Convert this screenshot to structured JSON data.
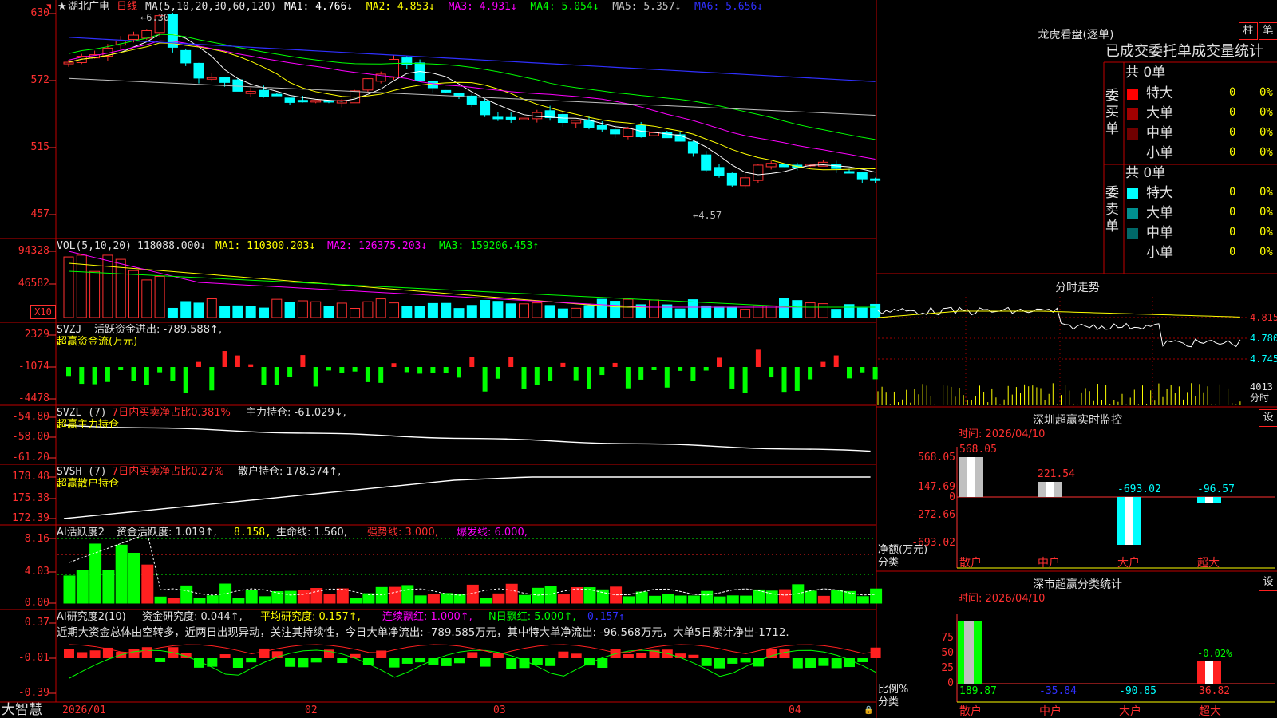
{
  "stock": {
    "star": "★",
    "name": "湖北广电",
    "period": "日线",
    "ma_label": "MA(5,10,20,30,60,120)",
    "ma": [
      {
        "label": "MA1:",
        "value": "4.766↓",
        "color": "#ffffff"
      },
      {
        "label": "MA2:",
        "value": "4.853↓",
        "color": "#ffff00"
      },
      {
        "label": "MA3:",
        "value": "4.931↓",
        "color": "#ff00ff"
      },
      {
        "label": "MA4:",
        "value": "5.054↓",
        "color": "#00ff00"
      },
      {
        "label": "MA5:",
        "value": "5.357↓",
        "color": "#c0c0c0"
      },
      {
        "label": "MA6:",
        "value": "5.656↓",
        "color": "#3030ff"
      }
    ],
    "high_mark": "6.30",
    "low_mark": "4.57"
  },
  "price_axis": [
    "630",
    "572",
    "515",
    "457"
  ],
  "vol": {
    "label": "VOL(5,10,20)",
    "value": "118088.000↓",
    "ma1": "MA1: 110300.203↓",
    "ma2": "MA2: 126375.203↓",
    "ma3": "MA3: 159206.453↑",
    "axis": [
      "94328",
      "46582"
    ],
    "unit": "X10"
  },
  "svzj": {
    "label": "SVZJ",
    "desc": "活跃资金进出: -789.588↑,",
    "sub": "超赢资金流(万元)",
    "axis": [
      "2329",
      "-1074",
      "-4478"
    ]
  },
  "svzl": {
    "label": "SVZL (7)",
    "desc1": "7日内买卖净占比0.381%",
    "desc2": "主力持仓: -61.029↓,",
    "sub": "超赢主力持仓",
    "axis": [
      "-54.80",
      "-58.00",
      "-61.20"
    ]
  },
  "svsh": {
    "label": "SVSH (7)",
    "desc1": "7日内买卖净占比0.27%",
    "desc2": "散户持仓: 178.374↑,",
    "sub": "超赢散户持仓",
    "axis": [
      "178.48",
      "175.38",
      "172.39"
    ]
  },
  "ai_active": {
    "label": "AI活跃度2",
    "a": "资金活跃度: 1.019↑,",
    "b": "8.158,",
    "c": "生命线: 1.560,",
    "d": "强势线: 3.000,",
    "e": "爆发线: 6.000,",
    "axis": [
      "8.16",
      "4.03",
      "0.00"
    ]
  },
  "ai_research": {
    "label": "AI研究度2(10)",
    "a": "资金研究度: 0.044↑,",
    "b": "平均研究度: 0.157↑,",
    "c": "连续飘红: 1.000↑,",
    "d": "N日飘红: 5.000↑,",
    "e": "0.157↑",
    "axis": [
      "0.37",
      "-0.01",
      "-0.39"
    ],
    "comment": "近期大资金总体由空转多，近两日出现异动，关注其持续性，今日大单净流出: -789.585万元，其中特大单净流出: -96.568万元，大单5日累计净出-1712."
  },
  "dates": [
    "2026/01",
    "02",
    "03",
    "04"
  ],
  "brand": "大智慧",
  "longhu": {
    "title": "龙虎看盘(逐单)",
    "btn1": "柱",
    "btn2": "笔",
    "subtitle": "已成交委托单成交量统计",
    "buy": {
      "side": "委买单",
      "total": "共 0单",
      "rows": [
        {
          "label": "特大",
          "v": "0",
          "p": "0%",
          "color": "#ff0000"
        },
        {
          "label": "大单",
          "v": "0",
          "p": "0%",
          "color": "#a00000"
        },
        {
          "label": "中单",
          "v": "0",
          "p": "0%",
          "color": "#700000"
        },
        {
          "label": "小单",
          "v": "0",
          "p": "0%",
          "color": "#000000"
        }
      ]
    },
    "sell": {
      "side": "委卖单",
      "total": "共 0单",
      "rows": [
        {
          "label": "特大",
          "v": "0",
          "p": "0%",
          "color": "#00ffff"
        },
        {
          "label": "大单",
          "v": "0",
          "p": "0%",
          "color": "#009090"
        },
        {
          "label": "中单",
          "v": "0",
          "p": "0%",
          "color": "#006868"
        },
        {
          "label": "小单",
          "v": "0",
          "p": "0%",
          "color": "#000000"
        }
      ]
    }
  },
  "intraday": {
    "title": "分时走势",
    "axis": [
      "4.815",
      "4.780",
      "4.745"
    ],
    "vol": "4013",
    "vol_unit": "分时"
  },
  "sz_monitor": {
    "title": "深圳超赢实时监控",
    "btn": "设",
    "time": "时间: 2026/04/10",
    "axis": [
      "568.05",
      "147.69",
      "0",
      "-272.66",
      "-693.02"
    ],
    "ylabel": "净额(万元)",
    "xlabel": "分类",
    "cats": [
      "散户",
      "中户",
      "大户",
      "超大"
    ],
    "values": [
      "568.05",
      "221.54",
      "-693.02",
      "-96.57"
    ]
  },
  "sz_class": {
    "title": "深市超赢分类统计",
    "btn": "设",
    "time": "时间: 2026/04/10",
    "axis": [
      "75",
      "50",
      "25",
      "0"
    ],
    "ylabel": "比例%",
    "xlabel": "分类",
    "cats": [
      "散户",
      "中户",
      "大户",
      "超大"
    ],
    "values": [
      "189.87",
      "-35.84",
      "-90.85",
      "36.82"
    ],
    "bar_label": "-0.02%"
  },
  "chart_data": [
    {
      "type": "candlestick",
      "title": "湖北广电 日线",
      "ylim": [
        457,
        630
      ],
      "high": 6.3,
      "low": 4.57,
      "ma": {
        "MA1": 4.766,
        "MA2": 4.853,
        "MA3": 4.931,
        "MA4": 5.054,
        "MA5": 5.357,
        "MA6": 5.656
      }
    },
    {
      "type": "bar",
      "title": "VOL(5,10,20)",
      "ylim": [
        0,
        94328
      ],
      "last": 118088.0
    },
    {
      "type": "bar",
      "title": "深圳超赢实时监控",
      "categories": [
        "散户",
        "中户",
        "大户",
        "超大"
      ],
      "values": [
        568.05,
        221.54,
        -693.02,
        -96.57
      ],
      "ylim": [
        -693.02,
        568.05
      ]
    },
    {
      "type": "bar",
      "title": "深市超赢分类统计",
      "categories": [
        "散户",
        "中户",
        "大户",
        "超大"
      ],
      "values": [
        189.87,
        -35.84,
        -90.85,
        36.82
      ],
      "ylim": [
        0,
        75
      ]
    }
  ]
}
